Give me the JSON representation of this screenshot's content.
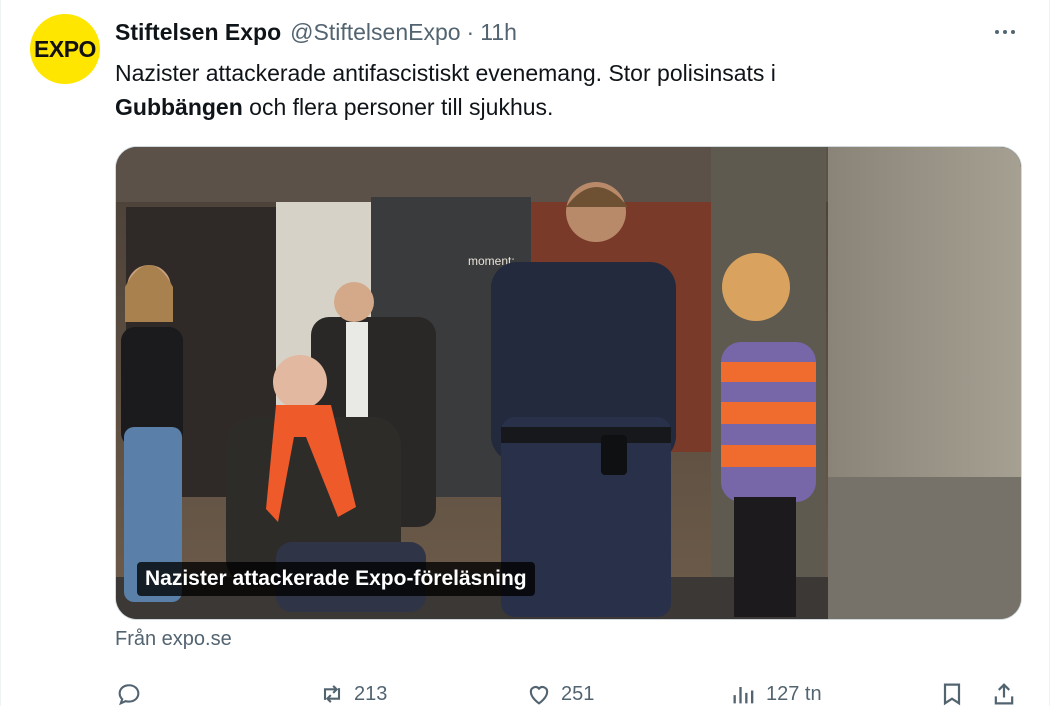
{
  "tweet": {
    "avatar_text": "EXPO",
    "display_name": "Stiftelsen Expo",
    "handle": "@StiftelsenExpo",
    "separator": "·",
    "time": "11h",
    "text_line1": "Nazister attackerade antifascistiskt evenemang. Stor polisinsats i",
    "text_bold": "Gubbängen",
    "text_rest": " och flera personer till sjukhus."
  },
  "media": {
    "sign_text": "moment:",
    "caption": "Nazister attackerade Expo-föreläsning",
    "source": "Från expo.se"
  },
  "actions": {
    "reply_count": "",
    "repost_count": "213",
    "like_count": "251",
    "views_count": "127 tn"
  },
  "icons": {
    "avatar": "expo-logo",
    "more": "more-icon",
    "reply": "reply-icon",
    "repost": "repost-icon",
    "like": "like-icon",
    "views": "views-icon",
    "bookmark": "bookmark-icon",
    "share": "share-icon"
  },
  "colors": {
    "text": "#0f1419",
    "secondary": "#536471",
    "avatar_bg": "#ffe600",
    "border": "#cfd9de"
  }
}
